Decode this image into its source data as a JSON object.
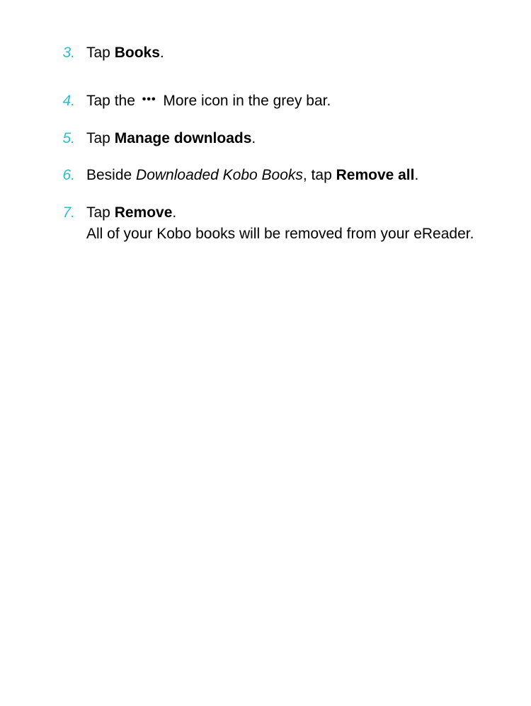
{
  "accentColor": "#2BBFCE",
  "steps": [
    {
      "number": "3.",
      "prefix": "Tap ",
      "bold1": "Books",
      "suffix1": "."
    },
    {
      "number": "4.",
      "prefix": "Tap the ",
      "iconGlyph": "•••",
      "mid": " More icon in the grey bar."
    },
    {
      "number": "5.",
      "prefix": "Tap ",
      "bold1": "Manage downloads",
      "suffix1": "."
    },
    {
      "number": "6.",
      "prefix": "Beside ",
      "italic1": "Downloaded Kobo Books",
      "mid": ", tap ",
      "bold1": "Remove all",
      "suffix1": "."
    },
    {
      "number": "7.",
      "prefix": "Tap ",
      "bold1": "Remove",
      "suffix1": ".",
      "secondary": "All of your Kobo books will be removed from your eReader."
    }
  ]
}
